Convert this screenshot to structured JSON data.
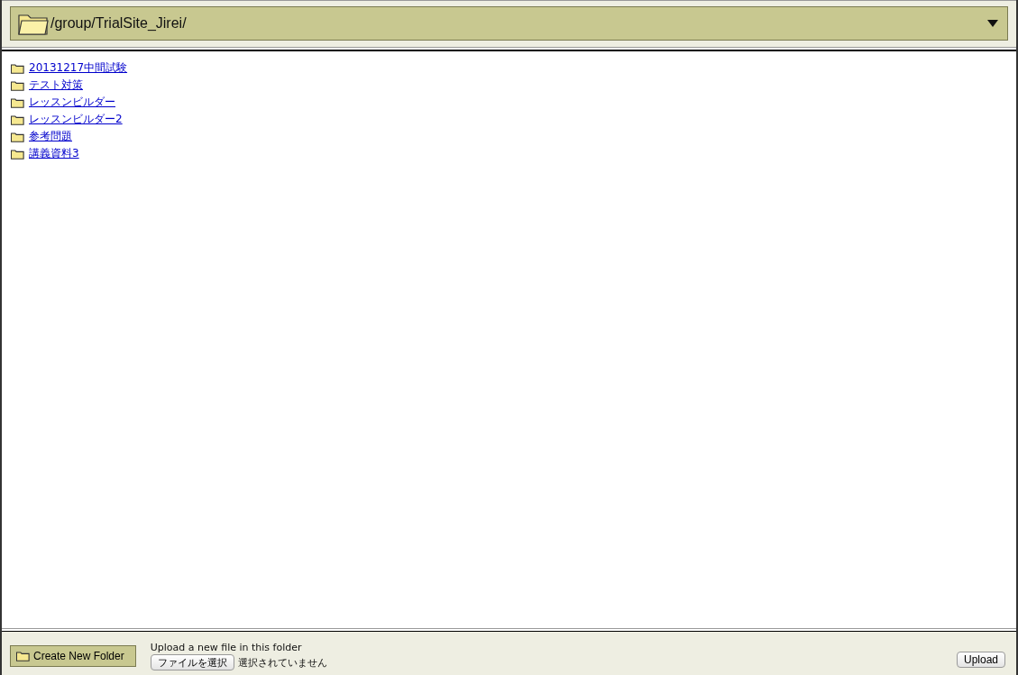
{
  "path_bar": {
    "path": "/group/TrialSite_Jirei/"
  },
  "folders": [
    {
      "name": "20131217中間試験"
    },
    {
      "name": "テスト対策"
    },
    {
      "name": "レッスンビルダー"
    },
    {
      "name": "レッスンビルダー2"
    },
    {
      "name": "参考問題"
    },
    {
      "name": "講義資料3"
    }
  ],
  "footer": {
    "create_folder_button": "Create New Folder",
    "upload_label": "Upload a new file in this folder",
    "file_button": "ファイルを選択",
    "file_status": "選択されていません",
    "upload_button": "Upload"
  }
}
